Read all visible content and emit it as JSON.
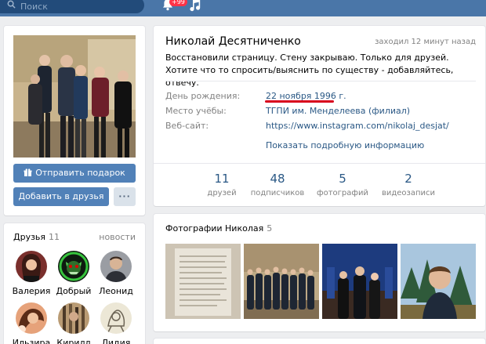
{
  "topbar": {
    "search_placeholder": "Поиск",
    "notifications_badge": "+99",
    "icons": [
      "search-icon",
      "bell-icon",
      "music-icon"
    ]
  },
  "profile": {
    "name": "Николай Десятниченко",
    "last_seen": "заходил 12 минут назад",
    "status": "Восстановили страницу. Стену закрываю. Только для друзей. Хотите что то спросить/выяснить по существу - добавляйтесь, отвечу.",
    "fields": [
      {
        "label": "День рождения:",
        "value": "22 ноября 1996 г."
      },
      {
        "label": "Место учёбы:",
        "value": "ТГПИ им. Менделеева (филиал)"
      },
      {
        "label": "Веб-сайт:",
        "value": "https://www.instagram.com/nikolaj_desjat/"
      }
    ],
    "show_more": "Показать подробную информацию",
    "counters": [
      {
        "num": "11",
        "label": "друзей"
      },
      {
        "num": "48",
        "label": "подписчиков"
      },
      {
        "num": "5",
        "label": "фотографий"
      },
      {
        "num": "2",
        "label": "видеозаписи"
      }
    ]
  },
  "actions": {
    "send_gift": "Отправить подарок",
    "add_friend": "Добавить в друзья",
    "more": "···"
  },
  "friends": {
    "title": "Друзья",
    "count": "11",
    "tab": "новости",
    "items": [
      {
        "name": "Валерия"
      },
      {
        "name": "Добрый"
      },
      {
        "name": "Леонид"
      },
      {
        "name": "Ильзира"
      },
      {
        "name": "Кирилл"
      },
      {
        "name": "Лидия"
      }
    ]
  },
  "photos": {
    "title": "Фотографии Николая",
    "count": "5"
  },
  "colors": {
    "header": "#4a76a8",
    "link": "#2a5885",
    "button": "#5181b8",
    "highlight_underline": "#d8001c"
  }
}
